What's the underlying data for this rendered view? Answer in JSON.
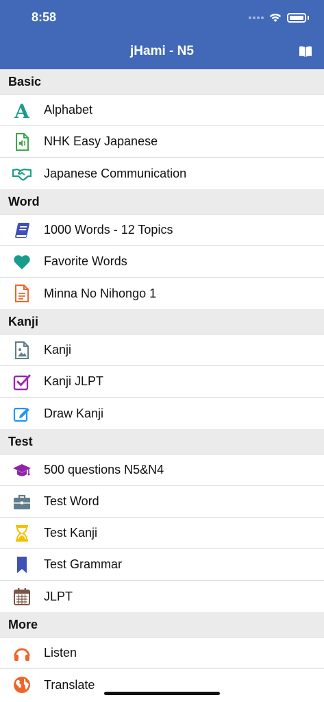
{
  "status_bar": {
    "time": "8:58"
  },
  "nav": {
    "title": "jHami - N5",
    "book_icon": "book-open-icon"
  },
  "sections": [
    {
      "title": "Basic",
      "items": [
        {
          "label": "Alphabet",
          "icon": "alphabet-icon",
          "color": "#1a9c8a"
        },
        {
          "label": "NHK Easy Japanese",
          "icon": "audio-file-icon",
          "color": "#3aa84a"
        },
        {
          "label": "Japanese Communication",
          "icon": "handshake-icon",
          "color": "#1a9c8a"
        }
      ]
    },
    {
      "title": "Word",
      "items": [
        {
          "label": "1000 Words - 12 Topics",
          "icon": "book-icon",
          "color": "#3f51b5"
        },
        {
          "label": "Favorite Words",
          "icon": "heart-icon",
          "color": "#1a9c8a"
        },
        {
          "label": "Minna No Nihongo 1",
          "icon": "document-icon",
          "color": "#f0642a"
        }
      ]
    },
    {
      "title": "Kanji",
      "items": [
        {
          "label": "Kanji",
          "icon": "image-file-icon",
          "color": "#607d8b"
        },
        {
          "label": "Kanji JLPT",
          "icon": "checkbox-icon",
          "color": "#9c27b0"
        },
        {
          "label": "Draw Kanji",
          "icon": "edit-icon",
          "color": "#2196f3"
        }
      ]
    },
    {
      "title": "Test",
      "items": [
        {
          "label": "500 questions N5&N4",
          "icon": "graduation-cap-icon",
          "color": "#8e24aa"
        },
        {
          "label": "Test Word",
          "icon": "briefcase-icon",
          "color": "#607d8b"
        },
        {
          "label": "Test Kanji",
          "icon": "hourglass-icon",
          "color": "#f5c000"
        },
        {
          "label": "Test Grammar",
          "icon": "bookmark-icon",
          "color": "#3f51b5"
        },
        {
          "label": "JLPT",
          "icon": "calendar-icon",
          "color": "#795548"
        }
      ]
    },
    {
      "title": "More",
      "items": [
        {
          "label": "Listen",
          "icon": "headphones-icon",
          "color": "#f0642a"
        },
        {
          "label": "Translate",
          "icon": "globe-icon",
          "color": "#f0642a"
        }
      ]
    }
  ],
  "colors": {
    "header": "#4169b8",
    "section_bg": "#ebebeb"
  }
}
